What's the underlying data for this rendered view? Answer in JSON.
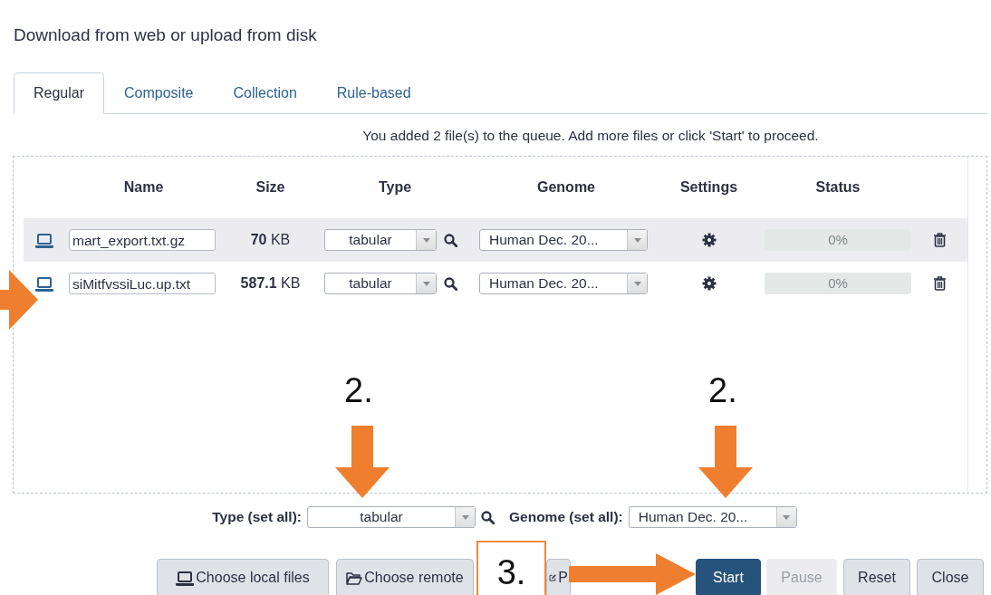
{
  "title": "Download from web or upload from disk",
  "tabs": [
    {
      "label": "Regular",
      "selected": true
    },
    {
      "label": "Composite",
      "selected": false
    },
    {
      "label": "Collection",
      "selected": false
    },
    {
      "label": "Rule-based",
      "selected": false
    }
  ],
  "message": "You added 2 file(s) to the queue. Add more files or click 'Start' to proceed.",
  "table": {
    "columns": [
      "Name",
      "Size",
      "Type",
      "Genome",
      "Settings",
      "Status"
    ],
    "rows": [
      {
        "name": "mart_export.txt.gz",
        "size": "70",
        "unit": "KB",
        "type": "tabular",
        "genome": "Human Dec. 20...",
        "status": "0%",
        "level": 0,
        "highlighted": true
      },
      {
        "name": "siMitfvssiLuc.up.txt",
        "size": "587.1",
        "unit": "KB",
        "type": "tabular",
        "genome": "Human Dec. 20...",
        "status": "0%",
        "level": 0,
        "highlighted": false
      }
    ]
  },
  "set_all": {
    "type_label": "Type (set all):",
    "type": "tabular",
    "genome_label": "Genome (set all):",
    "genome": "Human Dec. 20..."
  },
  "buttons": [
    {
      "label": "Choose local files",
      "kind": "local",
      "disabled": false
    },
    {
      "label": "Choose remote",
      "kind": "remote",
      "disabled": false
    },
    {
      "label": "P",
      "kind": "paste",
      "disabled": false
    },
    {
      "label": "Start",
      "kind": "primary",
      "disabled": false
    },
    {
      "label": "Pause",
      "kind": "plain",
      "disabled": true
    },
    {
      "label": "Reset",
      "kind": "plain",
      "disabled": false
    },
    {
      "label": "Close",
      "kind": "plain",
      "disabled": false
    }
  ],
  "annotations": [
    {
      "kind": "arrow-right"
    },
    {
      "kind": "label",
      "text": "2."
    },
    {
      "kind": "arrow-down"
    },
    {
      "kind": "label",
      "text": "2."
    },
    {
      "kind": "arrow-down"
    },
    {
      "kind": "boxed-label",
      "text": "3."
    },
    {
      "kind": "arrow-right"
    }
  ]
}
